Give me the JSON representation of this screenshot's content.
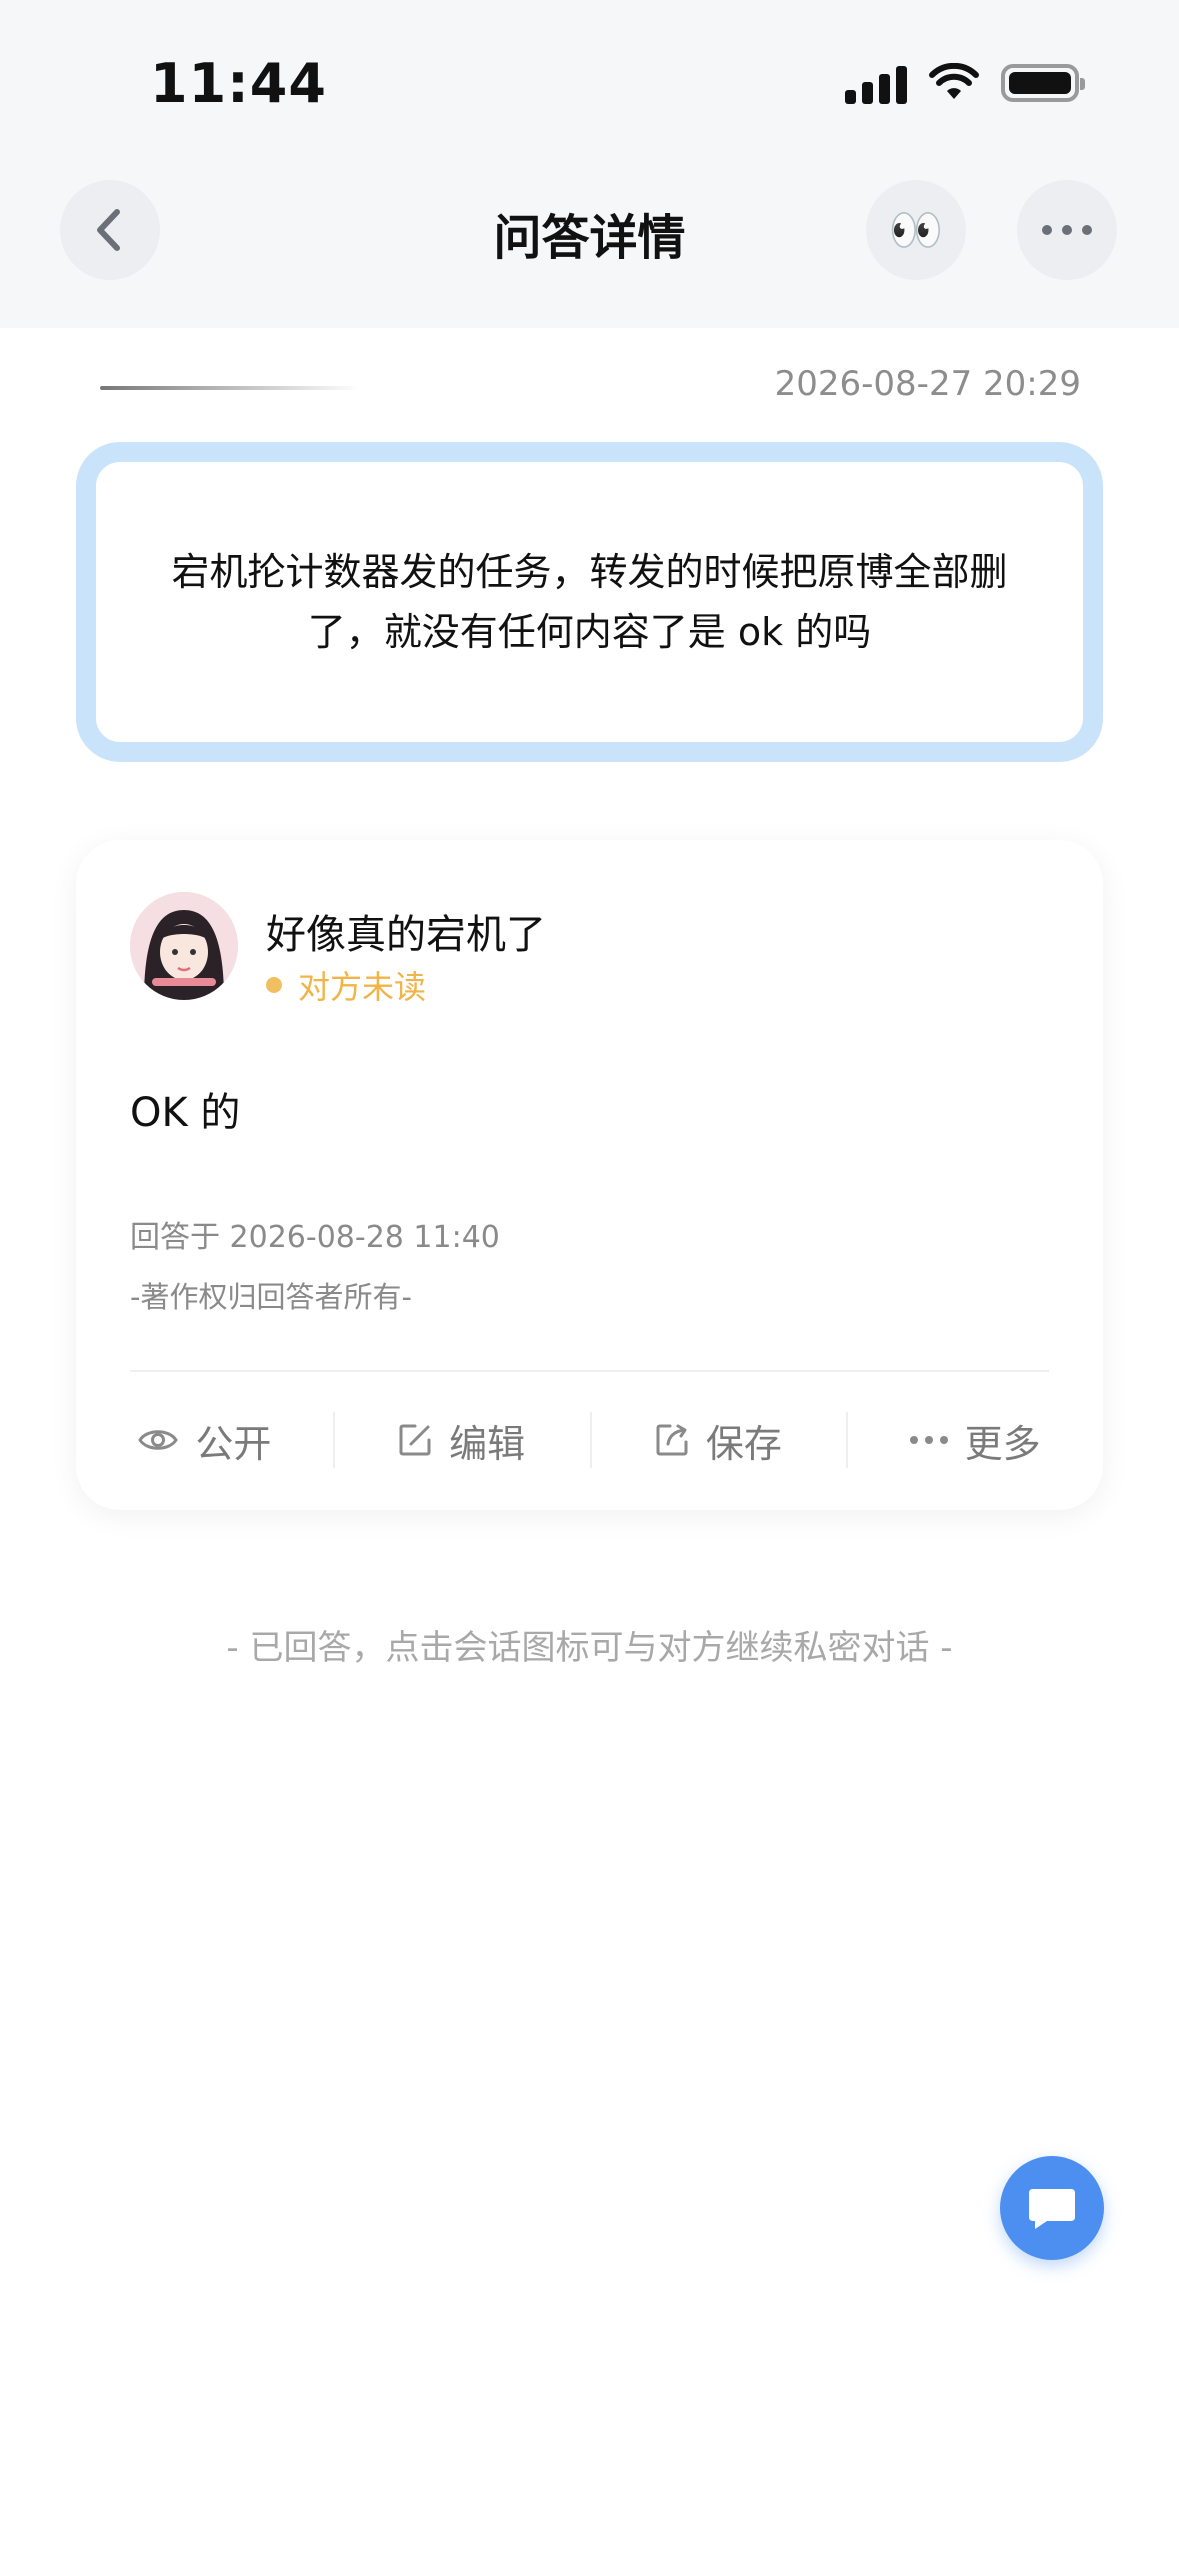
{
  "status_bar": {
    "time": "11:44"
  },
  "header": {
    "title": "问答详情",
    "eyes_icon": "👀"
  },
  "question": {
    "date": "2026-08-27 20:29",
    "text": "宕机抡计数器发的任务，转发的时候把原博全部删了，就没有任何内容了是 ok 的吗"
  },
  "answer": {
    "answerer_name": "好像真的宕机了",
    "read_status": "对方未读",
    "text": "OK 的",
    "answered_at": "回答于 2026-08-28 11:40",
    "copyright": "-著作权归回答者所有-",
    "actions": [
      {
        "label": "公开",
        "icon": "eye-icon"
      },
      {
        "label": "编辑",
        "icon": "edit-icon"
      },
      {
        "label": "保存",
        "icon": "share-icon"
      },
      {
        "label": "更多",
        "icon": "more-icon"
      }
    ]
  },
  "footer_hint": "- 已回答，点击会话图标可与对方继续私密对话 -",
  "colors": {
    "accent_blue": "#4d8ff0",
    "question_border": "#c9e3fb",
    "unread_orange": "#f0b448"
  }
}
